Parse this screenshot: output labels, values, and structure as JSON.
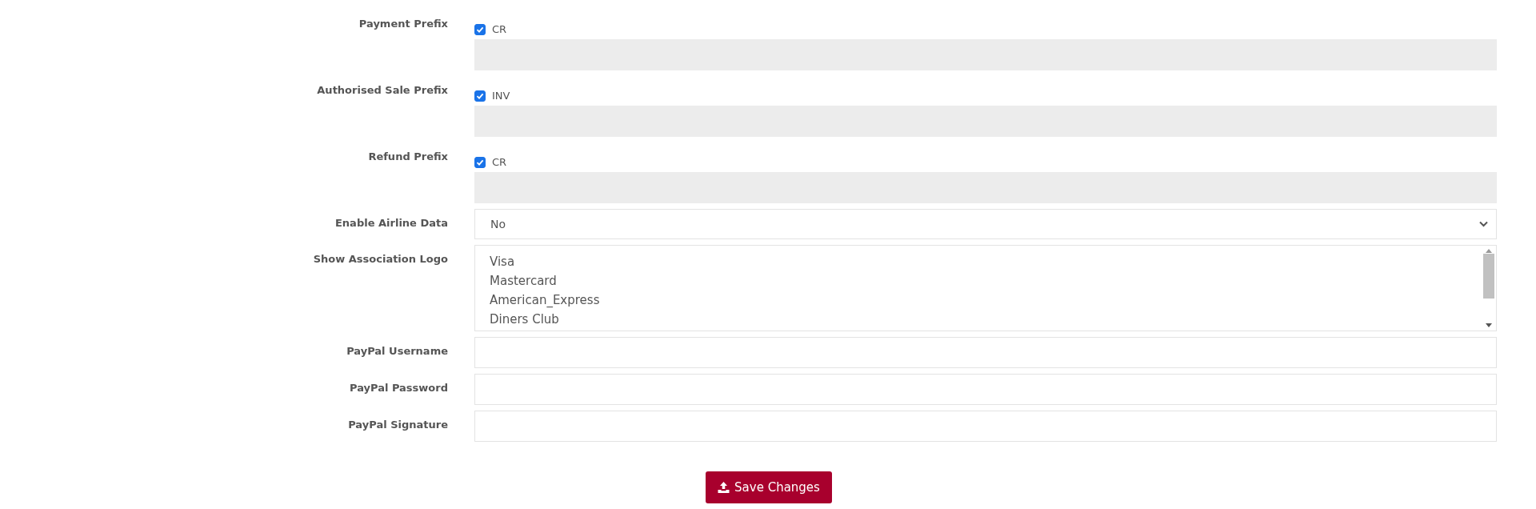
{
  "prefix_rows": [
    {
      "label": "Payment Prefix",
      "checkbox": {
        "label": "CR",
        "checked": true
      }
    },
    {
      "label": "Authorised Sale Prefix",
      "checkbox": {
        "label": "INV",
        "checked": true
      }
    },
    {
      "label": "Refund Prefix",
      "checkbox": {
        "label": "CR",
        "checked": true
      }
    }
  ],
  "airline": {
    "label": "Enable Airline Data",
    "value": "No"
  },
  "association_logo": {
    "label": "Show Association Logo",
    "options": [
      "Visa",
      "Mastercard",
      "American_Express",
      "Diners Club"
    ]
  },
  "text_fields": [
    {
      "label": "PayPal Username"
    },
    {
      "label": "PayPal Password"
    },
    {
      "label": "PayPal Signature"
    }
  ],
  "save_button": {
    "label": "Save Changes"
  }
}
